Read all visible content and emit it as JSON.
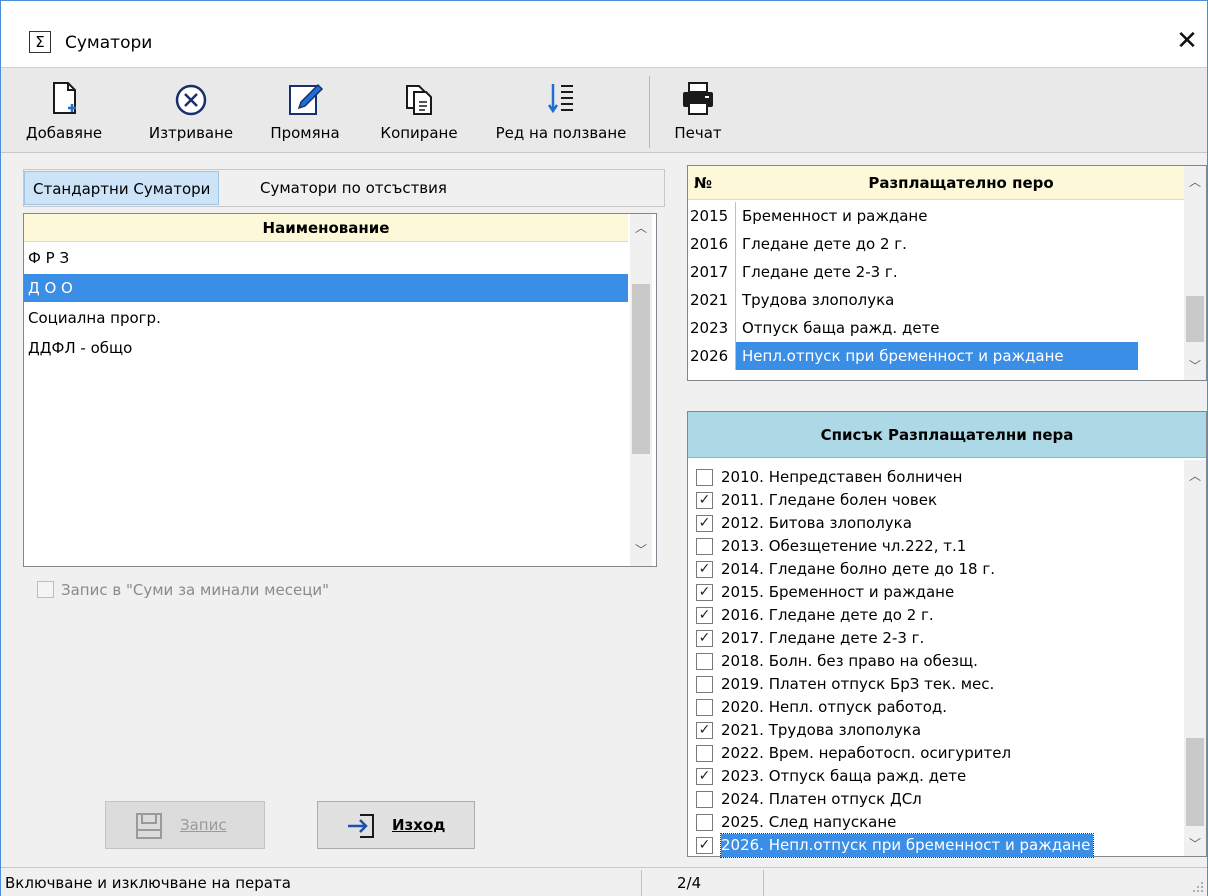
{
  "window": {
    "title": "Суматори",
    "title_icon": "Σ",
    "close": "✕"
  },
  "toolbar": {
    "add": "Добавяне",
    "delete": "Изтриване",
    "edit": "Промяна",
    "copy": "Копиране",
    "order": "Ред на ползване",
    "print": "Печат"
  },
  "tabs": [
    "Стандартни Суматори",
    "Суматори по отсъствия"
  ],
  "summators": {
    "header": "Наименование",
    "items": [
      "Ф Р З",
      "Д О О",
      "Социална прогр.",
      "ДДФЛ - общо"
    ],
    "selected_index": 1
  },
  "past_months_checkbox": {
    "label": "Запис в \"Суми за минали месеци\"",
    "checked": false,
    "enabled": false
  },
  "buttons": {
    "save": "Запис",
    "exit": "Изход"
  },
  "pay_items_grid": {
    "col_num": "№",
    "col_name": "Разплащателно перо",
    "rows": [
      {
        "num": "2015",
        "name": "Бременност и раждане"
      },
      {
        "num": "2016",
        "name": "Гледане дете до 2 г."
      },
      {
        "num": "2017",
        "name": "Гледане дете 2-3 г."
      },
      {
        "num": "2021",
        "name": "Трудова злополука"
      },
      {
        "num": "2023",
        "name": "Отпуск баща ражд. дете"
      },
      {
        "num": "2026",
        "name": "Непл.отпуск при бременност и раждане"
      }
    ],
    "selected_index": 5
  },
  "pay_items_list": {
    "header": "Списък Разплащателни пера",
    "items": [
      {
        "label": "2010. Непредставен болничен",
        "checked": false
      },
      {
        "label": "2011. Гледане болен човек",
        "checked": true
      },
      {
        "label": "2012. Битова злополука",
        "checked": true
      },
      {
        "label": "2013. Обезщетение чл.222, т.1",
        "checked": false
      },
      {
        "label": "2014. Гледане болно дете до 18 г.",
        "checked": true
      },
      {
        "label": "2015. Бременност и раждане",
        "checked": true
      },
      {
        "label": "2016. Гледане дете до 2 г.",
        "checked": true
      },
      {
        "label": "2017. Гледане дете 2-3 г.",
        "checked": true
      },
      {
        "label": "2018. Болн. без право на обезщ.",
        "checked": false
      },
      {
        "label": "2019. Платен отпуск БрЗ тек. мес.",
        "checked": false
      },
      {
        "label": "2020. Непл. отпуск работод.",
        "checked": false
      },
      {
        "label": "2021. Трудова злополука",
        "checked": true
      },
      {
        "label": "2022. Врем. неработосп. осигурител",
        "checked": false
      },
      {
        "label": "2023. Отпуск баща ражд. дете",
        "checked": true
      },
      {
        "label": "2024. Платен отпуск ДСл",
        "checked": false
      },
      {
        "label": "2025. След напускане",
        "checked": false
      },
      {
        "label": "2026. Непл.отпуск при бременност и раждане",
        "checked": true
      }
    ],
    "selected_index": 16
  },
  "statusbar": {
    "message": "Включване и изключване на перата",
    "position": "2/4"
  },
  "colors": {
    "selection": "#3a8ee6",
    "header_yellow": "#fdf8d8",
    "header_blue": "#add8e6"
  }
}
